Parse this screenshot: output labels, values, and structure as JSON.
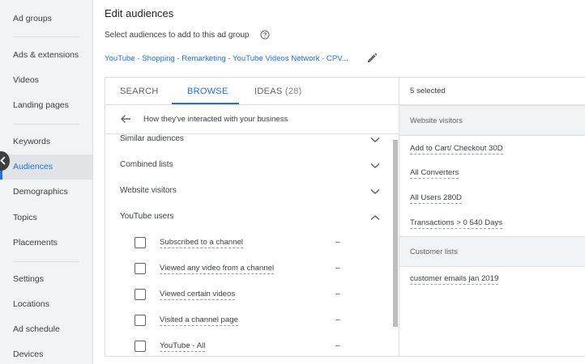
{
  "sidebar": {
    "items": [
      {
        "label": "Ad groups"
      },
      {
        "label": "Ads & extensions"
      },
      {
        "label": "Videos"
      },
      {
        "label": "Landing pages"
      },
      {
        "label": "Keywords"
      },
      {
        "label": "Audiences",
        "active": true
      },
      {
        "label": "Demographics"
      },
      {
        "label": "Topics"
      },
      {
        "label": "Placements"
      },
      {
        "label": "Settings"
      },
      {
        "label": "Locations"
      },
      {
        "label": "Ad schedule"
      },
      {
        "label": "Devices"
      }
    ],
    "collapse_icon": "chevron-left-icon",
    "accent": "#1a73e8"
  },
  "header": {
    "title": "Edit audiences",
    "subtitle": "Select audiences to add to this ad group",
    "help_icon": "help-circle-icon",
    "campaign_path": "YouTube - Shopping - Remarketing - YouTube Videos Network - CPV...",
    "edit_icon": "pencil-icon"
  },
  "tabs": [
    {
      "label": "SEARCH",
      "count": ""
    },
    {
      "label": "BROWSE",
      "count": "",
      "active": true
    },
    {
      "label": "IDEAS",
      "count": "(28)"
    }
  ],
  "browse": {
    "back_icon": "arrow-left-icon",
    "breadcrumb": "How they've interacted with your business",
    "categories": [
      {
        "label": "Similar audiences",
        "expanded": false
      },
      {
        "label": "Combined lists",
        "expanded": false
      },
      {
        "label": "Website visitors",
        "expanded": false
      },
      {
        "label": "YouTube users",
        "expanded": true
      }
    ],
    "youtube_items": [
      {
        "label": "Subscribed to a channel",
        "value": "–"
      },
      {
        "label": "Viewed any video from a channel",
        "value": "–"
      },
      {
        "label": "Viewed certain videos",
        "value": "–"
      },
      {
        "label": "Visited a channel page",
        "value": "–"
      },
      {
        "label": "YouTube - All",
        "value": "–"
      }
    ]
  },
  "selected": {
    "count_label": "5 selected",
    "groups": [
      {
        "header": "Website visitors",
        "items": [
          "Add to Cart/ Checkout 30D",
          "All Converters",
          "All Users 280D",
          "Transactions > 0 540 Days"
        ]
      },
      {
        "header": "Customer lists",
        "items": [
          "customer emails jan 2019"
        ]
      }
    ]
  }
}
